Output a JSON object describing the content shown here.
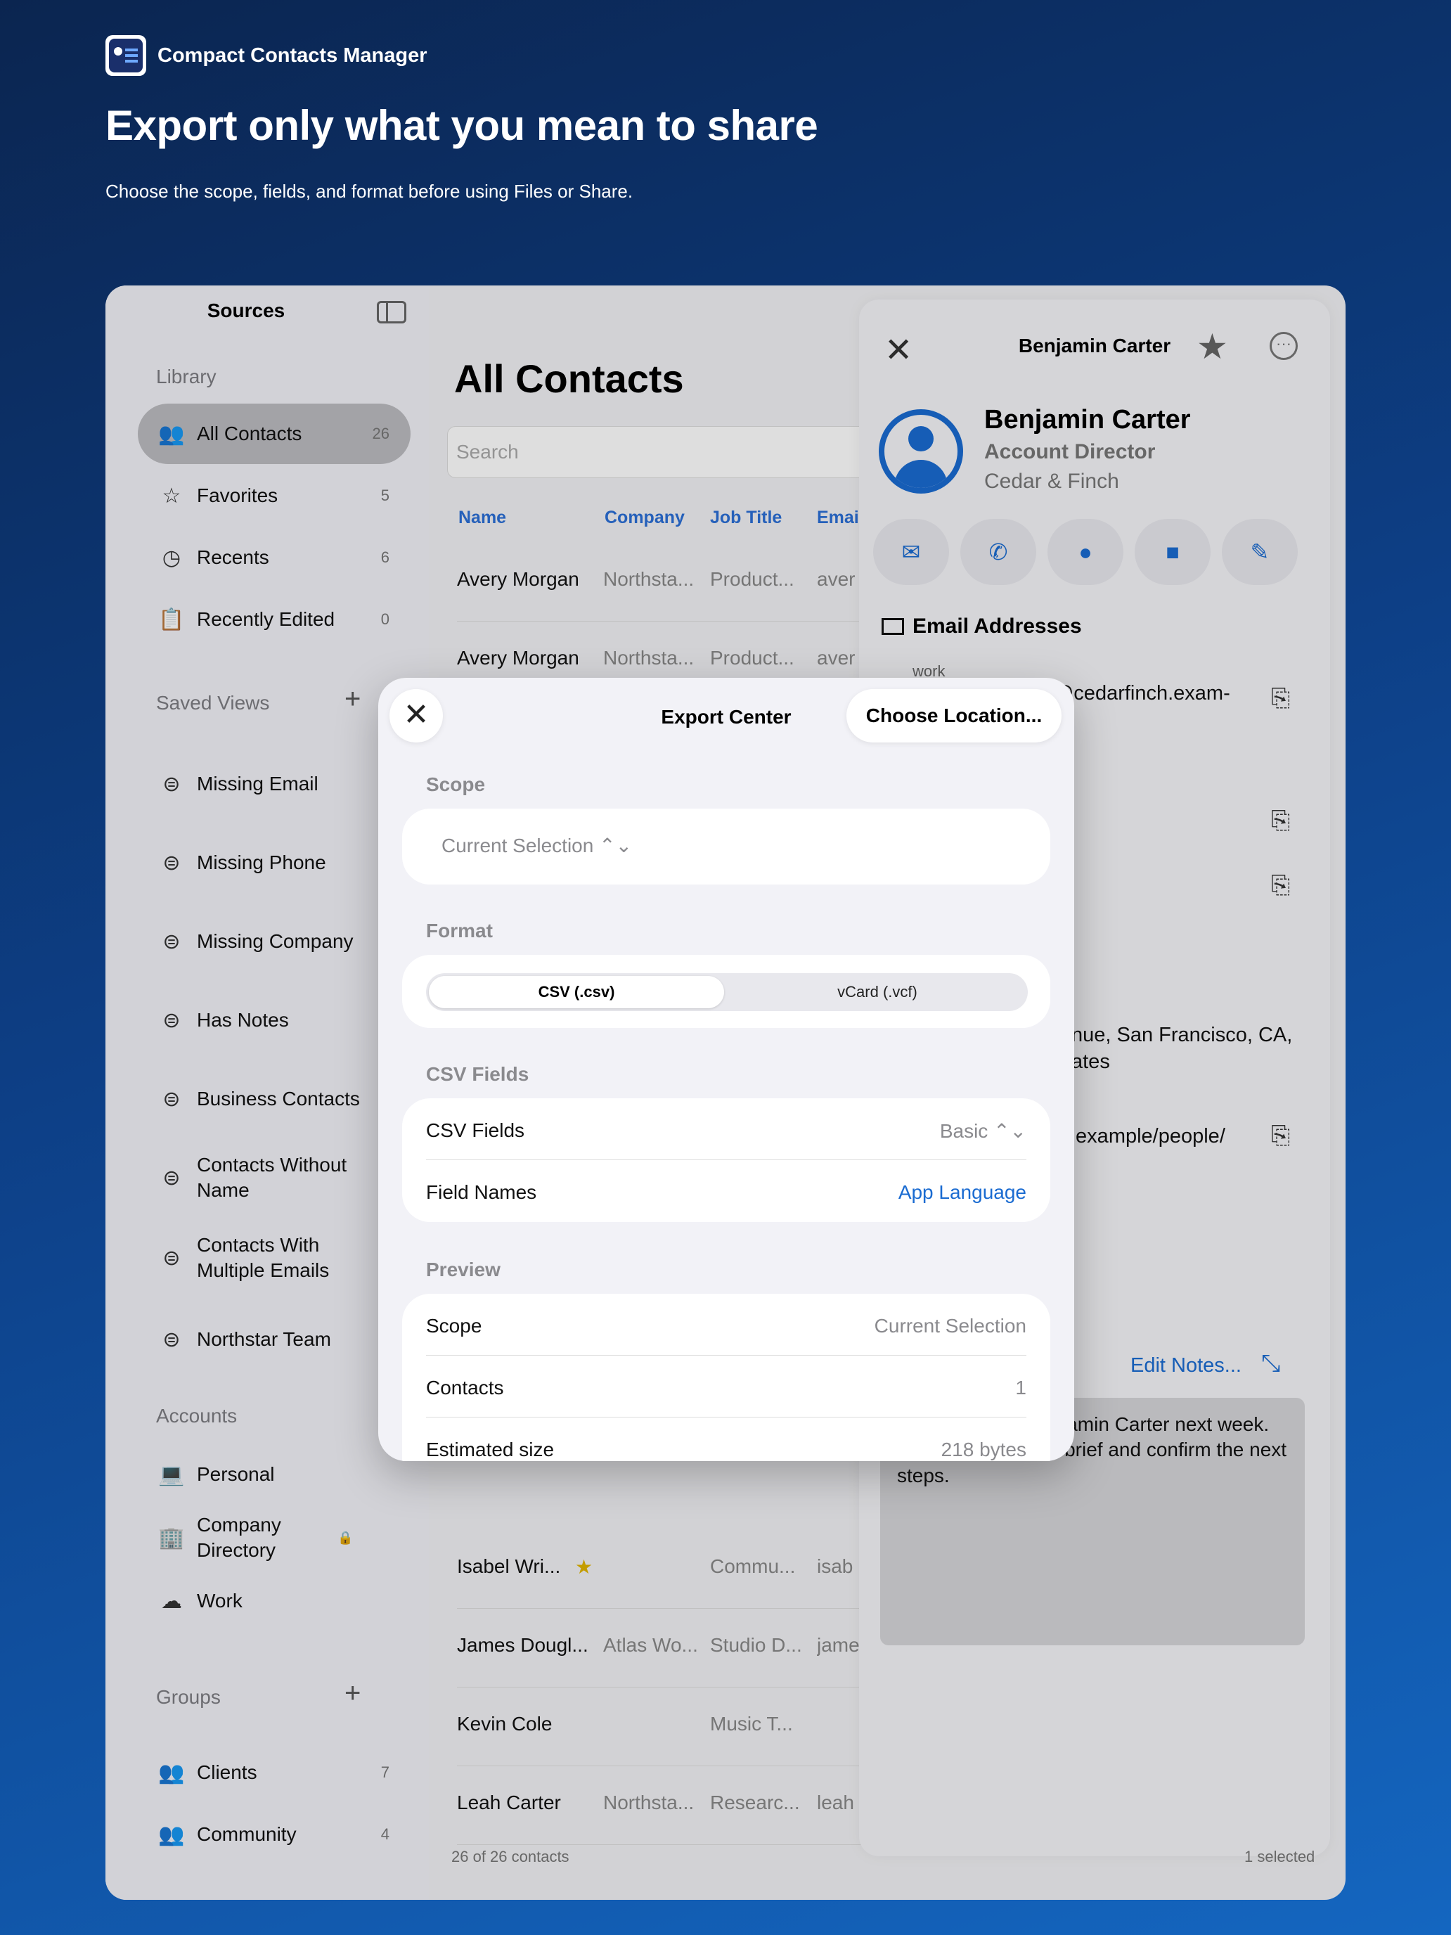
{
  "hero": {
    "app_name": "Compact Contacts Manager",
    "headline": "Export only what you mean to share",
    "subhead": "Choose the scope, fields, and format before using Files or Share."
  },
  "sidebar": {
    "title": "Sources",
    "library_label": "Library",
    "library": [
      {
        "label": "All Contacts",
        "count": "26",
        "icon": "people-icon",
        "glyph": "👥"
      },
      {
        "label": "Favorites",
        "count": "5",
        "icon": "star-icon",
        "glyph": "☆"
      },
      {
        "label": "Recents",
        "count": "6",
        "icon": "clock-icon",
        "glyph": "◷"
      },
      {
        "label": "Recently Edited",
        "count": "0",
        "icon": "clipboard-icon",
        "glyph": "📋"
      }
    ],
    "saved_views_label": "Saved Views",
    "saved_views": [
      {
        "label": "Missing Email"
      },
      {
        "label": "Missing Phone"
      },
      {
        "label": "Missing Company"
      },
      {
        "label": "Has Notes"
      },
      {
        "label": "Business Contacts"
      },
      {
        "label": "Contacts Without Name"
      },
      {
        "label": "Contacts With Multiple Emails"
      },
      {
        "label": "Northstar Team"
      }
    ],
    "accounts_label": "Accounts",
    "accounts": [
      {
        "label": "Personal",
        "icon": "laptop-icon",
        "glyph": "💻"
      },
      {
        "label": "Company Directory",
        "icon": "building-icon",
        "glyph": "🏢",
        "locked": "🔒"
      },
      {
        "label": "Work",
        "icon": "cloud-icon",
        "glyph": "☁"
      }
    ],
    "groups_label": "Groups",
    "groups": [
      {
        "label": "Clients",
        "count": "7"
      },
      {
        "label": "Community",
        "count": "4"
      }
    ]
  },
  "list": {
    "title": "All Contacts",
    "search_placeholder": "Search",
    "columns": [
      "Name",
      "Company",
      "Job Title",
      "Emai"
    ],
    "rows_top": [
      {
        "name": "Avery Morgan",
        "company": "Northsta...",
        "job": "Product...",
        "email": "aver"
      },
      {
        "name": "Avery Morgan",
        "company": "Northsta...",
        "job": "Product...",
        "email": "aver"
      }
    ],
    "rows_bottom": [
      {
        "name": "Isabel Wri...",
        "company": "",
        "job": "Commu...",
        "email": "isab",
        "star": "★"
      },
      {
        "name": "James Dougl...",
        "company": "Atlas Wo...",
        "job": "Studio D...",
        "email": "jame"
      },
      {
        "name": "Kevin Cole",
        "company": "",
        "job": "Music T...",
        "email": ""
      },
      {
        "name": "Leah Carter",
        "company": "Northsta...",
        "job": "Researc...",
        "email": "leah"
      }
    ],
    "footer": "26 of 26 contacts"
  },
  "detail": {
    "title": "Benjamin Carter",
    "name": "Benjamin Carter",
    "role": "Account Director",
    "company": "Cedar & Finch",
    "email_section": "Email Addresses",
    "email_label": "work",
    "email": "benjamin.carter@cedarfinch.exam-",
    "address": "nue, San Francisco, CA, ates",
    "url": ".example/people/",
    "edit_notes": "Edit Notes...",
    "notes": "Follow up with Benjamin Carter next week. Review the project brief and confirm the next steps.",
    "footer": "1 selected"
  },
  "export": {
    "title": "Export Center",
    "choose_location": "Choose Location...",
    "scope_label": "Scope",
    "scope_value": "Current Selection ⌃⌄",
    "format_label": "Format",
    "format_options": [
      "CSV (.csv)",
      "vCard (.vcf)"
    ],
    "csv_fields_label": "CSV Fields",
    "csv_fields_row": {
      "key": "CSV Fields",
      "value": "Basic ⌃⌄"
    },
    "field_names_row": {
      "key": "Field Names",
      "value": "App Language"
    },
    "preview_label": "Preview",
    "preview": [
      {
        "key": "Scope",
        "value": "Current Selection"
      },
      {
        "key": "Contacts",
        "value": "1"
      },
      {
        "key": "Estimated size",
        "value": "218 bytes"
      }
    ]
  }
}
